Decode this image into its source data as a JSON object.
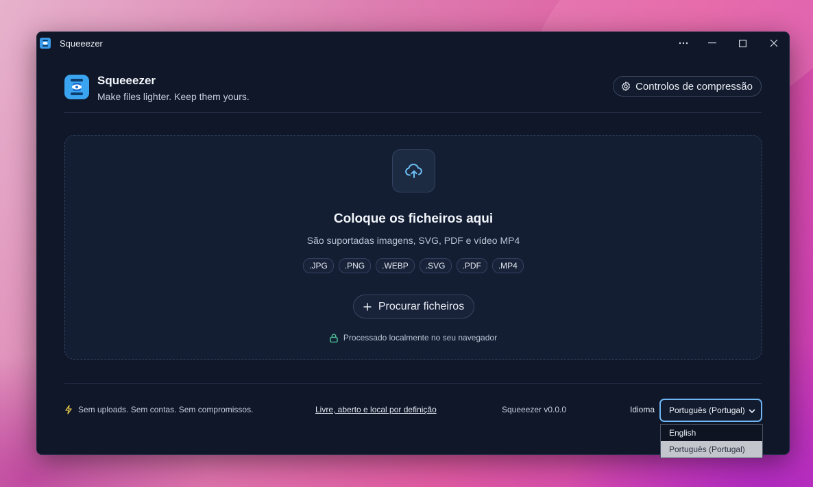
{
  "window": {
    "title": "Squeeezer",
    "controls": [
      "more-icon",
      "minimize-icon",
      "maximize-icon",
      "close-icon"
    ]
  },
  "header": {
    "app_name": "Squeeezer",
    "tagline": "Make files lighter. Keep them yours.",
    "compression_button": "Controlos de compressão"
  },
  "dropzone": {
    "title": "Coloque os ficheiros aqui",
    "subtitle": "São suportadas imagens, SVG, PDF e vídeo MP4",
    "formats": [
      ".JPG",
      ".PNG",
      ".WEBP",
      ".SVG",
      ".PDF",
      ".MP4"
    ],
    "browse_button": "Procurar ficheiros",
    "local_note": "Processado localmente no seu navegador"
  },
  "footer": {
    "no_uploads": "Sem uploads. Sem contas. Sem compromissos.",
    "link": "Livre, aberto e local por definição",
    "version": "Squeeezer v0.0.0",
    "language_label": "Idioma",
    "language_selected": "Português (Portugal)",
    "language_options": [
      "English",
      "Português (Portugal)"
    ]
  },
  "colors": {
    "window_bg": "#0f1729",
    "dropzone_bg": "#131e33",
    "accent": "#3ba4f0",
    "focus_ring": "#6fb6f4",
    "lock_green": "#4fc39a",
    "bolt_yellow": "#e6c84a"
  }
}
